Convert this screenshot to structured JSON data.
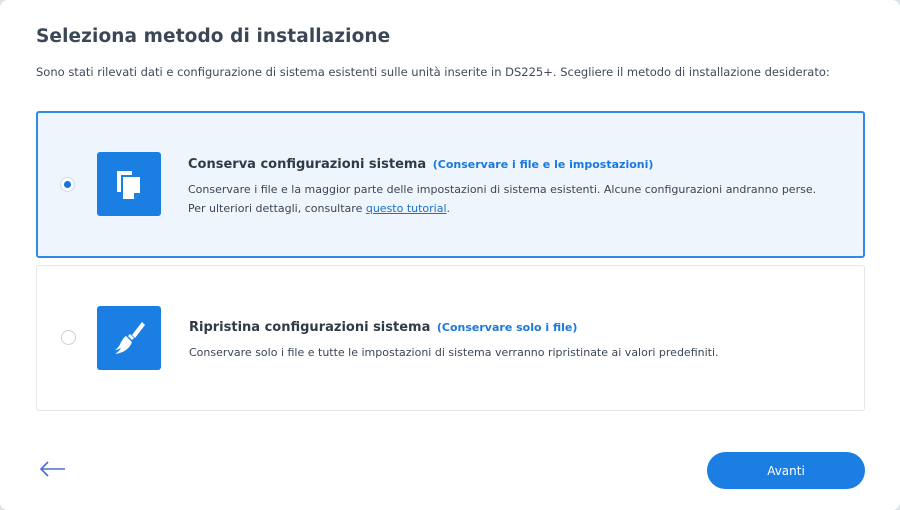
{
  "dialog": {
    "title": "Seleziona metodo di installazione",
    "subtitle": "Sono stati rilevati dati e configurazione di sistema esistenti sulle unità inserite in DS225+. Scegliere il metodo di installazione desiderato:"
  },
  "options": [
    {
      "selected": true,
      "icon": "copy-files-icon",
      "title": "Conserva configurazioni sistema",
      "hint": "(Conservare i file e le impostazioni)",
      "desc_before_link": "Conservare i file e la maggior parte delle impostazioni di sistema esistenti. Alcune configurazioni andranno perse. Per ulteriori dettagli, consultare ",
      "link_text": "questo tutorial",
      "desc_after_link": "."
    },
    {
      "selected": false,
      "icon": "broom-icon",
      "title": "Ripristina configurazioni sistema",
      "hint": "(Conservare solo i file)",
      "desc": "Conservare solo i file e tutte le impostazioni di sistema verranno ripristinate ai valori predefiniti."
    }
  ],
  "footer": {
    "back_icon": "arrow-left-icon",
    "next_label": "Avanti"
  },
  "colors": {
    "accent": "#1a7ee3",
    "selected_bg": "#eef5fd",
    "selected_border": "#2f8be7",
    "back_arrow": "#4f6bd6"
  }
}
